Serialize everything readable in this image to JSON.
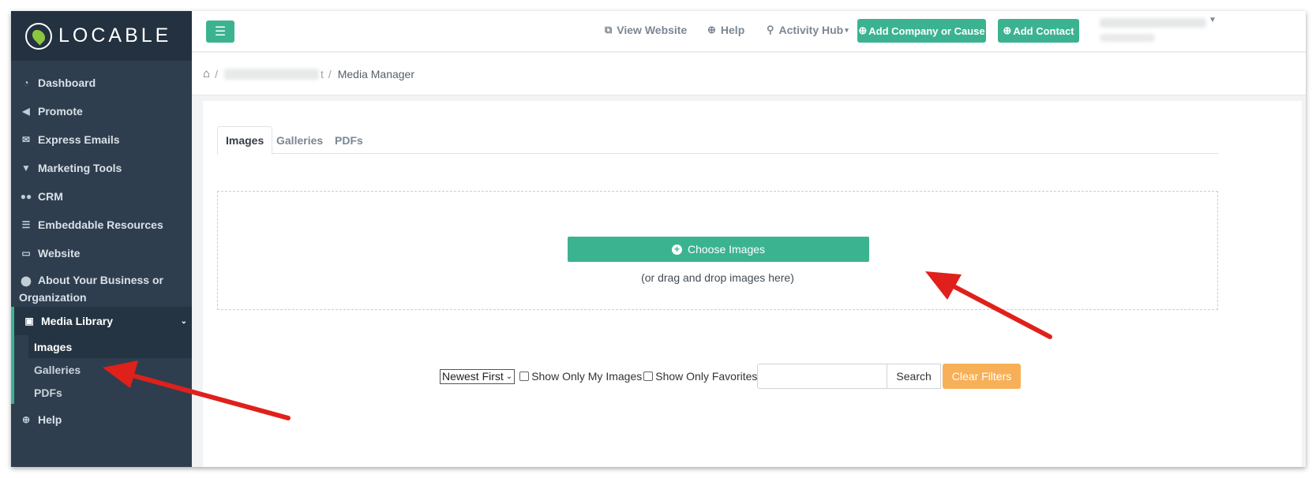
{
  "brand": {
    "name": "LOCABLE",
    "accent": "#3bb391",
    "sidebar_bg": "#2f3e4e",
    "orange": "#f7b057"
  },
  "sidebar": {
    "items": [
      {
        "label": "Dashboard",
        "icon": "gauge-icon"
      },
      {
        "label": "Promote",
        "icon": "megaphone-icon"
      },
      {
        "label": "Express Emails",
        "icon": "envelope-icon"
      },
      {
        "label": "Marketing Tools",
        "icon": "filter-icon"
      },
      {
        "label": "CRM",
        "icon": "users-icon"
      },
      {
        "label": "Embeddable Resources",
        "icon": "signpost-icon"
      },
      {
        "label": "Website",
        "icon": "monitor-icon"
      },
      {
        "label": "About Your Business or Organization",
        "icon": "map-pin-icon"
      },
      {
        "label": "Media Library",
        "icon": "image-icon"
      },
      {
        "label": "Help",
        "icon": "lifebuoy-icon"
      }
    ],
    "media_sub": [
      {
        "label": "Images"
      },
      {
        "label": "Galleries"
      },
      {
        "label": "PDFs"
      }
    ]
  },
  "topbar": {
    "view_website": "View Website",
    "help": "Help",
    "activity_hub": "Activity Hub",
    "add_company": "Add Company or Cause",
    "add_contact": "Add Contact"
  },
  "breadcrumb": {
    "tail": "t",
    "current": "Media Manager"
  },
  "tabs": [
    {
      "label": "Images"
    },
    {
      "label": "Galleries"
    },
    {
      "label": "PDFs"
    }
  ],
  "upload": {
    "button": "Choose Images",
    "hint": "(or drag and drop images here)"
  },
  "filters": {
    "sort": "Newest First",
    "only_mine": "Show Only My Images",
    "only_fav": "Show Only Favorites",
    "search_value": "",
    "search": "Search",
    "clear": "Clear Filters"
  }
}
